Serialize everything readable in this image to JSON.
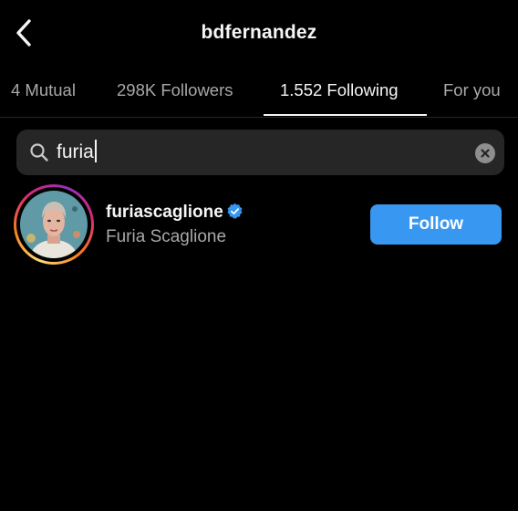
{
  "header": {
    "title": "bdfernandez",
    "back_icon": "chevron-left-icon"
  },
  "tabs": [
    {
      "label": "4 Mutual",
      "active": false
    },
    {
      "label": "298K Followers",
      "active": false
    },
    {
      "label": "1.552 Following",
      "active": true
    },
    {
      "label": "For you",
      "active": false
    }
  ],
  "search": {
    "value": "furia",
    "icon": "search-icon",
    "clear_icon": "clear-icon"
  },
  "results": [
    {
      "username": "furiascaglione",
      "full_name": "Furia Scaglione",
      "verified": true,
      "button_label": "Follow"
    }
  ],
  "colors": {
    "background": "#000000",
    "accent": "#3897f0",
    "secondary_text": "#a8a8a8",
    "search_bg": "#262626"
  }
}
